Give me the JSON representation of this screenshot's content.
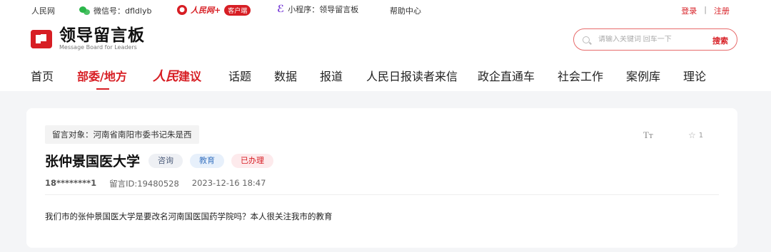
{
  "topbar": {
    "rmw": "人民网",
    "wechat": "微信号：dfldlyb",
    "rmw_plus_brand": "人民网+",
    "rmw_plus_client": "客户端",
    "miniprogram": "小程序：领导留言板",
    "help": "帮助中心",
    "login": "登录",
    "separator": "|",
    "register": "注册"
  },
  "header": {
    "logo_cn": "领导留言板",
    "logo_en": "Message Board for Leaders",
    "search_placeholder": "请输入关键词 回车一下",
    "search_button": "搜索"
  },
  "nav": {
    "items": [
      "首页",
      "部委/地方",
      "人民建议",
      "话题",
      "数据",
      "报道",
      "人民日报读者来信",
      "政企直通车",
      "社会工作",
      "案例库",
      "理论"
    ],
    "rmjy_prefix": "人民",
    "rmjy_suffix": "建议",
    "active_index": 1
  },
  "message": {
    "target": "留言对象：河南省南阳市委书记朱是西",
    "font_toggle": "Tт",
    "fav_count": "1",
    "title": "张仲景国医大学",
    "tags": [
      "咨询",
      "教育",
      "已办理"
    ],
    "user": "18********1",
    "message_id": "留言ID:19480528",
    "datetime": "2023-12-16 18:47",
    "content": "我们市的张仲景国医大学是要改名河南国医国药学院吗？本人很关注我市的教育"
  },
  "colors": {
    "brand_red": "#d71e24",
    "wechat_green": "#2bb64a",
    "tag_consult_bg": "#eef0f4",
    "tag_edu_bg": "#e7f0fb",
    "tag_done_bg": "#fdeaec"
  },
  "icons": [
    "wechat-icon",
    "rmw-plus-logo-icon",
    "miniprogram-icon",
    "search-icon",
    "font-size-icon",
    "star-icon"
  ]
}
